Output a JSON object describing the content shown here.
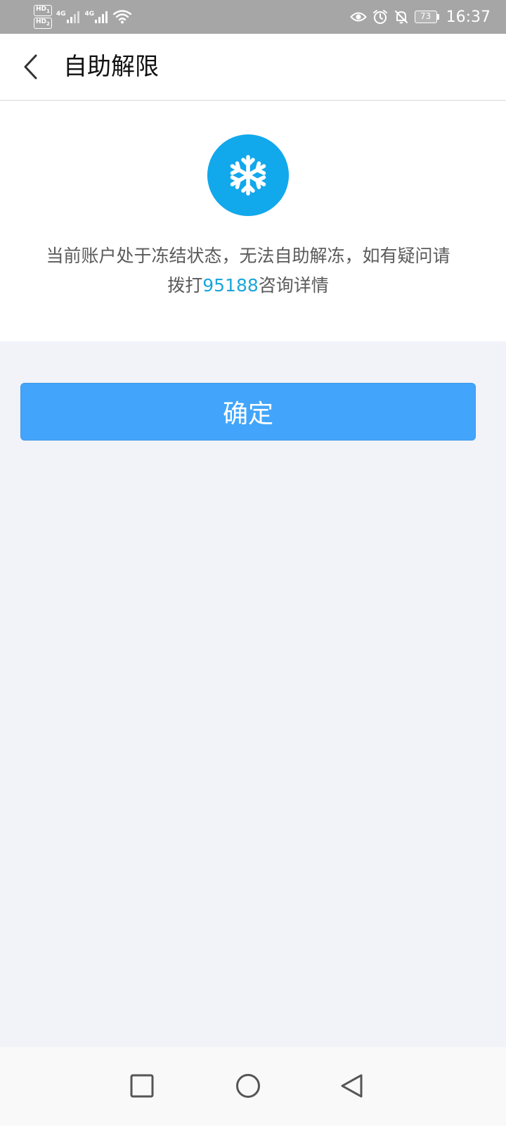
{
  "status_bar": {
    "hd_badges": [
      "HD",
      "HD"
    ],
    "sim_slots": [
      "1",
      "2"
    ],
    "network_1": "4G",
    "network_2": "4G",
    "battery_level": "73",
    "time": "16:37",
    "icons": [
      "wifi-icon",
      "eye-icon",
      "alarm-icon",
      "mute-icon",
      "battery-icon"
    ]
  },
  "header": {
    "title": "自助解限",
    "back_icon": "chevron-left-icon"
  },
  "content": {
    "icon": "snowflake-icon",
    "icon_color": "#12a8ec",
    "message_part1": "当前账户处于冻结状态，无法自助解冻，如有疑问请拨打",
    "phone_number": "95188",
    "message_part2": "咨询详情",
    "link_color": "#1ba6dc"
  },
  "confirm_button": {
    "label": "确定",
    "color": "#42a5fb"
  },
  "nav_bar": {
    "icons": [
      "recents-square-icon",
      "home-circle-icon",
      "back-triangle-icon"
    ]
  }
}
